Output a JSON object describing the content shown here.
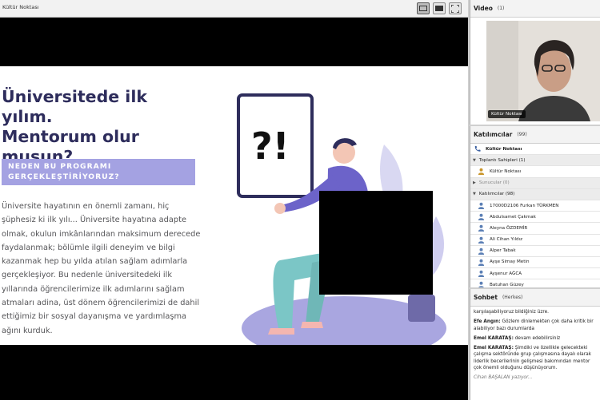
{
  "share": {
    "title": "Kültür Noktası"
  },
  "slide": {
    "title_line1": "Üniversitede ilk yılım.",
    "title_line2": "Mentorum olur",
    "title_line3": "musun?",
    "banner_line1": "NEDEN BU PROGRAMI",
    "banner_line2": "GERÇEKLEŞTİRİYORUZ?",
    "body": "Üniversite hayatının en önemli zamanı, hiç şüphesiz ki ilk yılı... Üniversite hayatına adapte olmak, okulun imkânlarından maksimum derecede faydalanmak; bölümle ilgili deneyim ve bilgi kazanmak hep bu yılda atılan sağlam adımlarla gerçekleşiyor. Bu nedenle üniversitedeki ilk yıllarında öğrencilerimize ilk adımlarını sağlam atmaları adina, üst dönem öğrencilerimizi de dahil ettiğimiz bir sosyal dayanışma ve yardımlaşma ağını kurduk.",
    "sign_text": "?!"
  },
  "video": {
    "title": "Video",
    "count": "(1)",
    "name": "Kültür Noktası"
  },
  "attendees": {
    "title": "Katılımcılar",
    "count": "(99)",
    "self": "Kültür Noktası",
    "hosts_label": "Toplantı Sahipleri (1)",
    "host": "Kültür Noktası",
    "presenters_label": "Sunucular (0)",
    "participants_label": "Katılımcılar (98)",
    "participants": [
      "17000D2106 Furkan TÜRKMEN",
      "Abdulsamet Çakmak",
      "Aleyna ÖZDEMİR",
      "Ali Cihan Yıldız",
      "Alper Tabak",
      "Ayşe Simay Metin",
      "Ayşenur AĞCA",
      "Batuhan Güzey"
    ]
  },
  "chat": {
    "title": "Sohbet",
    "scope": "(Herkes)",
    "messages": [
      {
        "who": "",
        "text": "karşılaşabiliyoruz bildiğiniz üzre."
      },
      {
        "who": "Efe Angın:",
        "text": "Gözlem dinlemekten çok daha kritik bir alabiliyor bazı durumlarda"
      },
      {
        "who": "Emel KARATAŞ:",
        "text": "devam edebilirsiniz"
      },
      {
        "who": "Emel KARATAŞ:",
        "text": "Şimdiki ve özellikle gelecekteki çalışma sektöründe grup çalışmasına dayalı olarak liderlik becerilerinin gelişmesi bakımından mentor çok önemli olduğunu düşünüyorum."
      }
    ],
    "typing": "Cihan BAŞALAN yazıyor..."
  },
  "colors": {
    "title": "#2e2d5c",
    "banner": "#a4a2e2",
    "body_text": "#555558",
    "shape_lavender": "#a9a6e0",
    "person_shirt": "#6c63c9",
    "person_pants": "#7bc6c6"
  }
}
